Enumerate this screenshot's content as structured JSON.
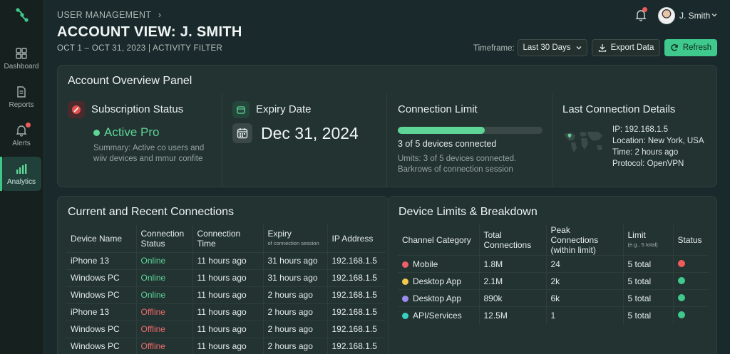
{
  "sidebar": {
    "items": [
      {
        "label": "Dashboard"
      },
      {
        "label": "Reports"
      },
      {
        "label": "Alerts"
      },
      {
        "label": "Analytics"
      }
    ]
  },
  "header": {
    "breadcrumb": "USER MANAGEMENT",
    "title": "ACCOUNT VIEW: J. SMITH",
    "subtitle": "OCT 1 – OCT 31, 2023 | ACTIVITY FILTER",
    "user_name": "J. Smith",
    "timeframe_label": "Timeframe:",
    "timeframe_value": "Last 30 Days",
    "export_label": "Export Data",
    "refresh_label": "Refresh"
  },
  "overview": {
    "title": "Account Overview Panel",
    "subscription": {
      "title": "Subscription Status",
      "status": "Active Pro",
      "summary_line1": "Summary: Active co users and",
      "summary_line2": "wiiv devices and mmur confite"
    },
    "expiry": {
      "title": "Expiry Date",
      "date": "Dec 31, 2024"
    },
    "connection_limit": {
      "title": "Connection Limit",
      "progress": 0.6,
      "summary": "3 of 5 devices connected",
      "detail_line1": "Umits: 3 of 5 devices connected.",
      "detail_line2": "Barkrows of connection session"
    },
    "last_connection": {
      "title": "Last Connection Details",
      "ip": "IP: 192.168.1.5",
      "location": "Location: New York, USA",
      "time": "Time: 2 hours ago",
      "protocol": "Protocol: OpenVPN"
    }
  },
  "connections": {
    "title": "Current and Recent Connections",
    "headers": {
      "device": "Device Name",
      "status_line1": "Connection",
      "status_line2": "Status",
      "time": "Connection Time",
      "expiry": "Expiry",
      "expiry_note": "of connection session",
      "ip": "IP Address"
    },
    "rows": [
      {
        "device": "iPhone 13",
        "status": "Online",
        "time": "11 hours ago",
        "expiry": "31 hours ago",
        "ip": "192.168.1.5"
      },
      {
        "device": "Windows PC",
        "status": "Online",
        "time": "11 hours ago",
        "expiry": "31 hours ago",
        "ip": "192.168.1.5"
      },
      {
        "device": "Windows PC",
        "status": "Online",
        "time": "11 hours ago",
        "expiry": "2 hours ago",
        "ip": "192.168.1.5"
      },
      {
        "device": "iPhone 13",
        "status": "Offline",
        "time": "11 hours ago",
        "expiry": "2 hours ago",
        "ip": "192.168.1.5"
      },
      {
        "device": "Windows PC",
        "status": "Offline",
        "time": "11 hours ago",
        "expiry": "2 hours ago",
        "ip": "192.168.1.5"
      },
      {
        "device": "Windows PC",
        "status": "Offline",
        "time": "11 hours ago",
        "expiry": "2 hours ago",
        "ip": "192.168.1.5"
      }
    ]
  },
  "limits": {
    "title": "Device Limits & Breakdown",
    "headers": {
      "category": "Channel Category",
      "total_line1": "Total",
      "total_line2": "Connections",
      "peak_line1": "Peak Connections",
      "peak_line2": "(within limit)",
      "limit": "Limit",
      "limit_note": "(e.g., 5 total)",
      "status": "Status"
    },
    "rows": [
      {
        "category": "Mobile",
        "color": "#ef5f6a",
        "total": "1.8M",
        "peak": "24",
        "limit": "5 total",
        "status_color": "#ef5a5a"
      },
      {
        "category": "Desktop App",
        "color": "#f2c94c",
        "total": "2.1M",
        "peak": "2k",
        "limit": "5 total",
        "status_color": "#3fc98d"
      },
      {
        "category": "Desktop App",
        "color": "#9b8cf0",
        "total": "890k",
        "peak": "6k",
        "limit": "5 total",
        "status_color": "#3fc98d"
      },
      {
        "category": "API/Services",
        "color": "#39d0c4",
        "total": "12.5M",
        "peak": "1",
        "limit": "5 total",
        "status_color": "#3fc98d"
      }
    ]
  },
  "colors": {
    "accent": "#3fc98d",
    "online": "#5fd497",
    "offline": "#ef6a6a",
    "alert": "#ef5a5a"
  }
}
